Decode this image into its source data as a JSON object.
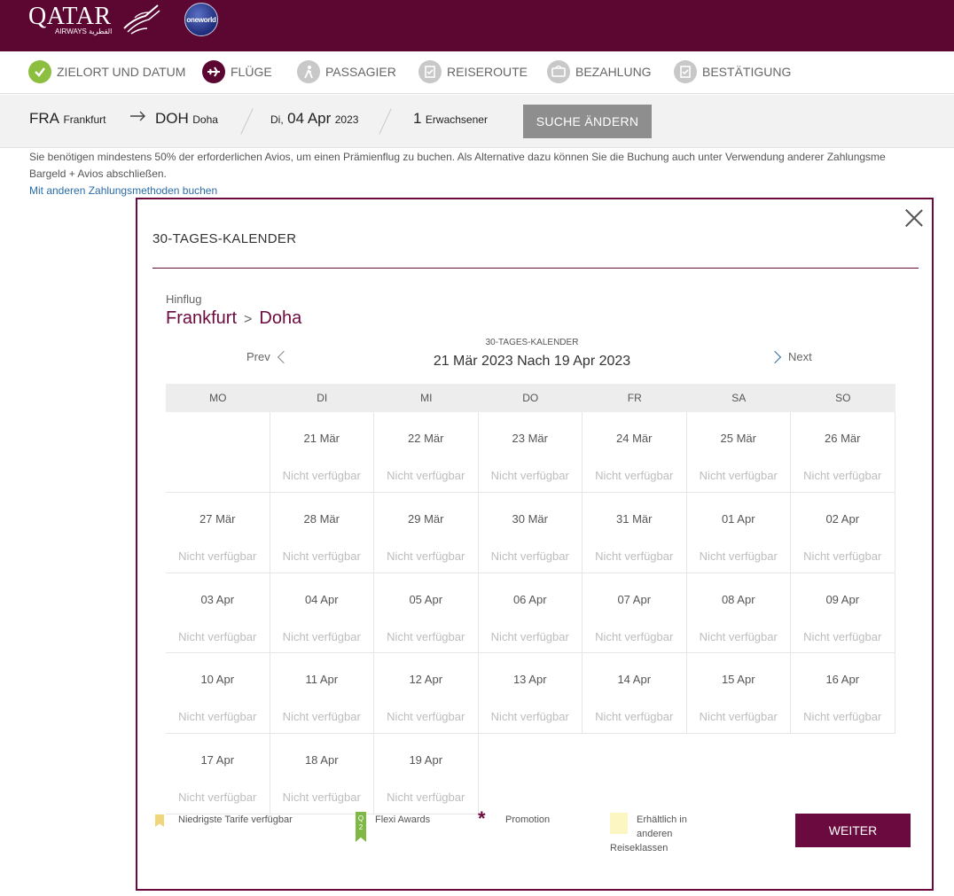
{
  "header": {
    "logo_text": "QATAR",
    "logo_sub": "AIRWAYS القطرية",
    "alliance": "oneworld"
  },
  "steps": [
    {
      "label": "ZIELORT UND DATUM",
      "state": "done"
    },
    {
      "label": "FLÜGE",
      "state": "active"
    },
    {
      "label": "PASSAGIER",
      "state": "todo"
    },
    {
      "label": "REISEROUTE",
      "state": "todo"
    },
    {
      "label": "BEZAHLUNG",
      "state": "todo"
    },
    {
      "label": "BESTÄTIGUNG",
      "state": "todo"
    }
  ],
  "summary": {
    "origin_code": "FRA",
    "origin_city": "Frankfurt",
    "dest_code": "DOH",
    "dest_city": "Doha",
    "weekday": "Di,",
    "date": "04 Apr",
    "year": "2023",
    "pax_count": "1",
    "pax_label": "Erwachsener",
    "change_label": "SUCHE ÄNDERN"
  },
  "notice": {
    "line1": "Sie benötigen mindestens 50% der erforderlichen Avios, um einen Prämienflug zu buchen. Als Alternative dazu können Sie die Buchung auch unter Verwendung anderer Zahlungsme",
    "line2": "Bargeld + Avios abschließen.",
    "link": "Mit anderen Zahlungsmethoden buchen"
  },
  "modal": {
    "title": "30-TAGES-KALENDER",
    "direction": "Hinflug",
    "from": "Frankfurt",
    "to": "Doha",
    "prev": "Prev",
    "next": "Next",
    "range_label": "30-TAGES-KALENDER",
    "range": "21 Mär 2023 Nach 19 Apr 2023",
    "weekdays": [
      "MO",
      "DI",
      "MI",
      "DO",
      "FR",
      "SA",
      "SO"
    ],
    "unavailable": "Nicht verfügbar",
    "leading_blanks": 1,
    "days": [
      "21 Mär",
      "22 Mär",
      "23 Mär",
      "24 Mär",
      "25 Mär",
      "26 Mär",
      "27 Mär",
      "28 Mär",
      "29 Mär",
      "30 Mär",
      "31 Mär",
      "01 Apr",
      "02 Apr",
      "03 Apr",
      "04 Apr",
      "05 Apr",
      "06 Apr",
      "07 Apr",
      "08 Apr",
      "09 Apr",
      "10 Apr",
      "11 Apr",
      "12 Apr",
      "13 Apr",
      "14 Apr",
      "15 Apr",
      "16 Apr",
      "17 Apr",
      "18 Apr",
      "19 Apr"
    ],
    "legend": {
      "lowest": "Niedrigste Tarife verfügbar",
      "flexi": "Flexi Awards",
      "flexi_badge": "Q 2",
      "promo": "Promotion",
      "other_1": "Erhältlich in",
      "other_2": "anderen",
      "other_3": "Reiseklassen"
    },
    "continue": "WEITER"
  },
  "colors": {
    "brand": "#5c0632",
    "accent": "#6b0a3e",
    "done": "#8cbe3f"
  }
}
